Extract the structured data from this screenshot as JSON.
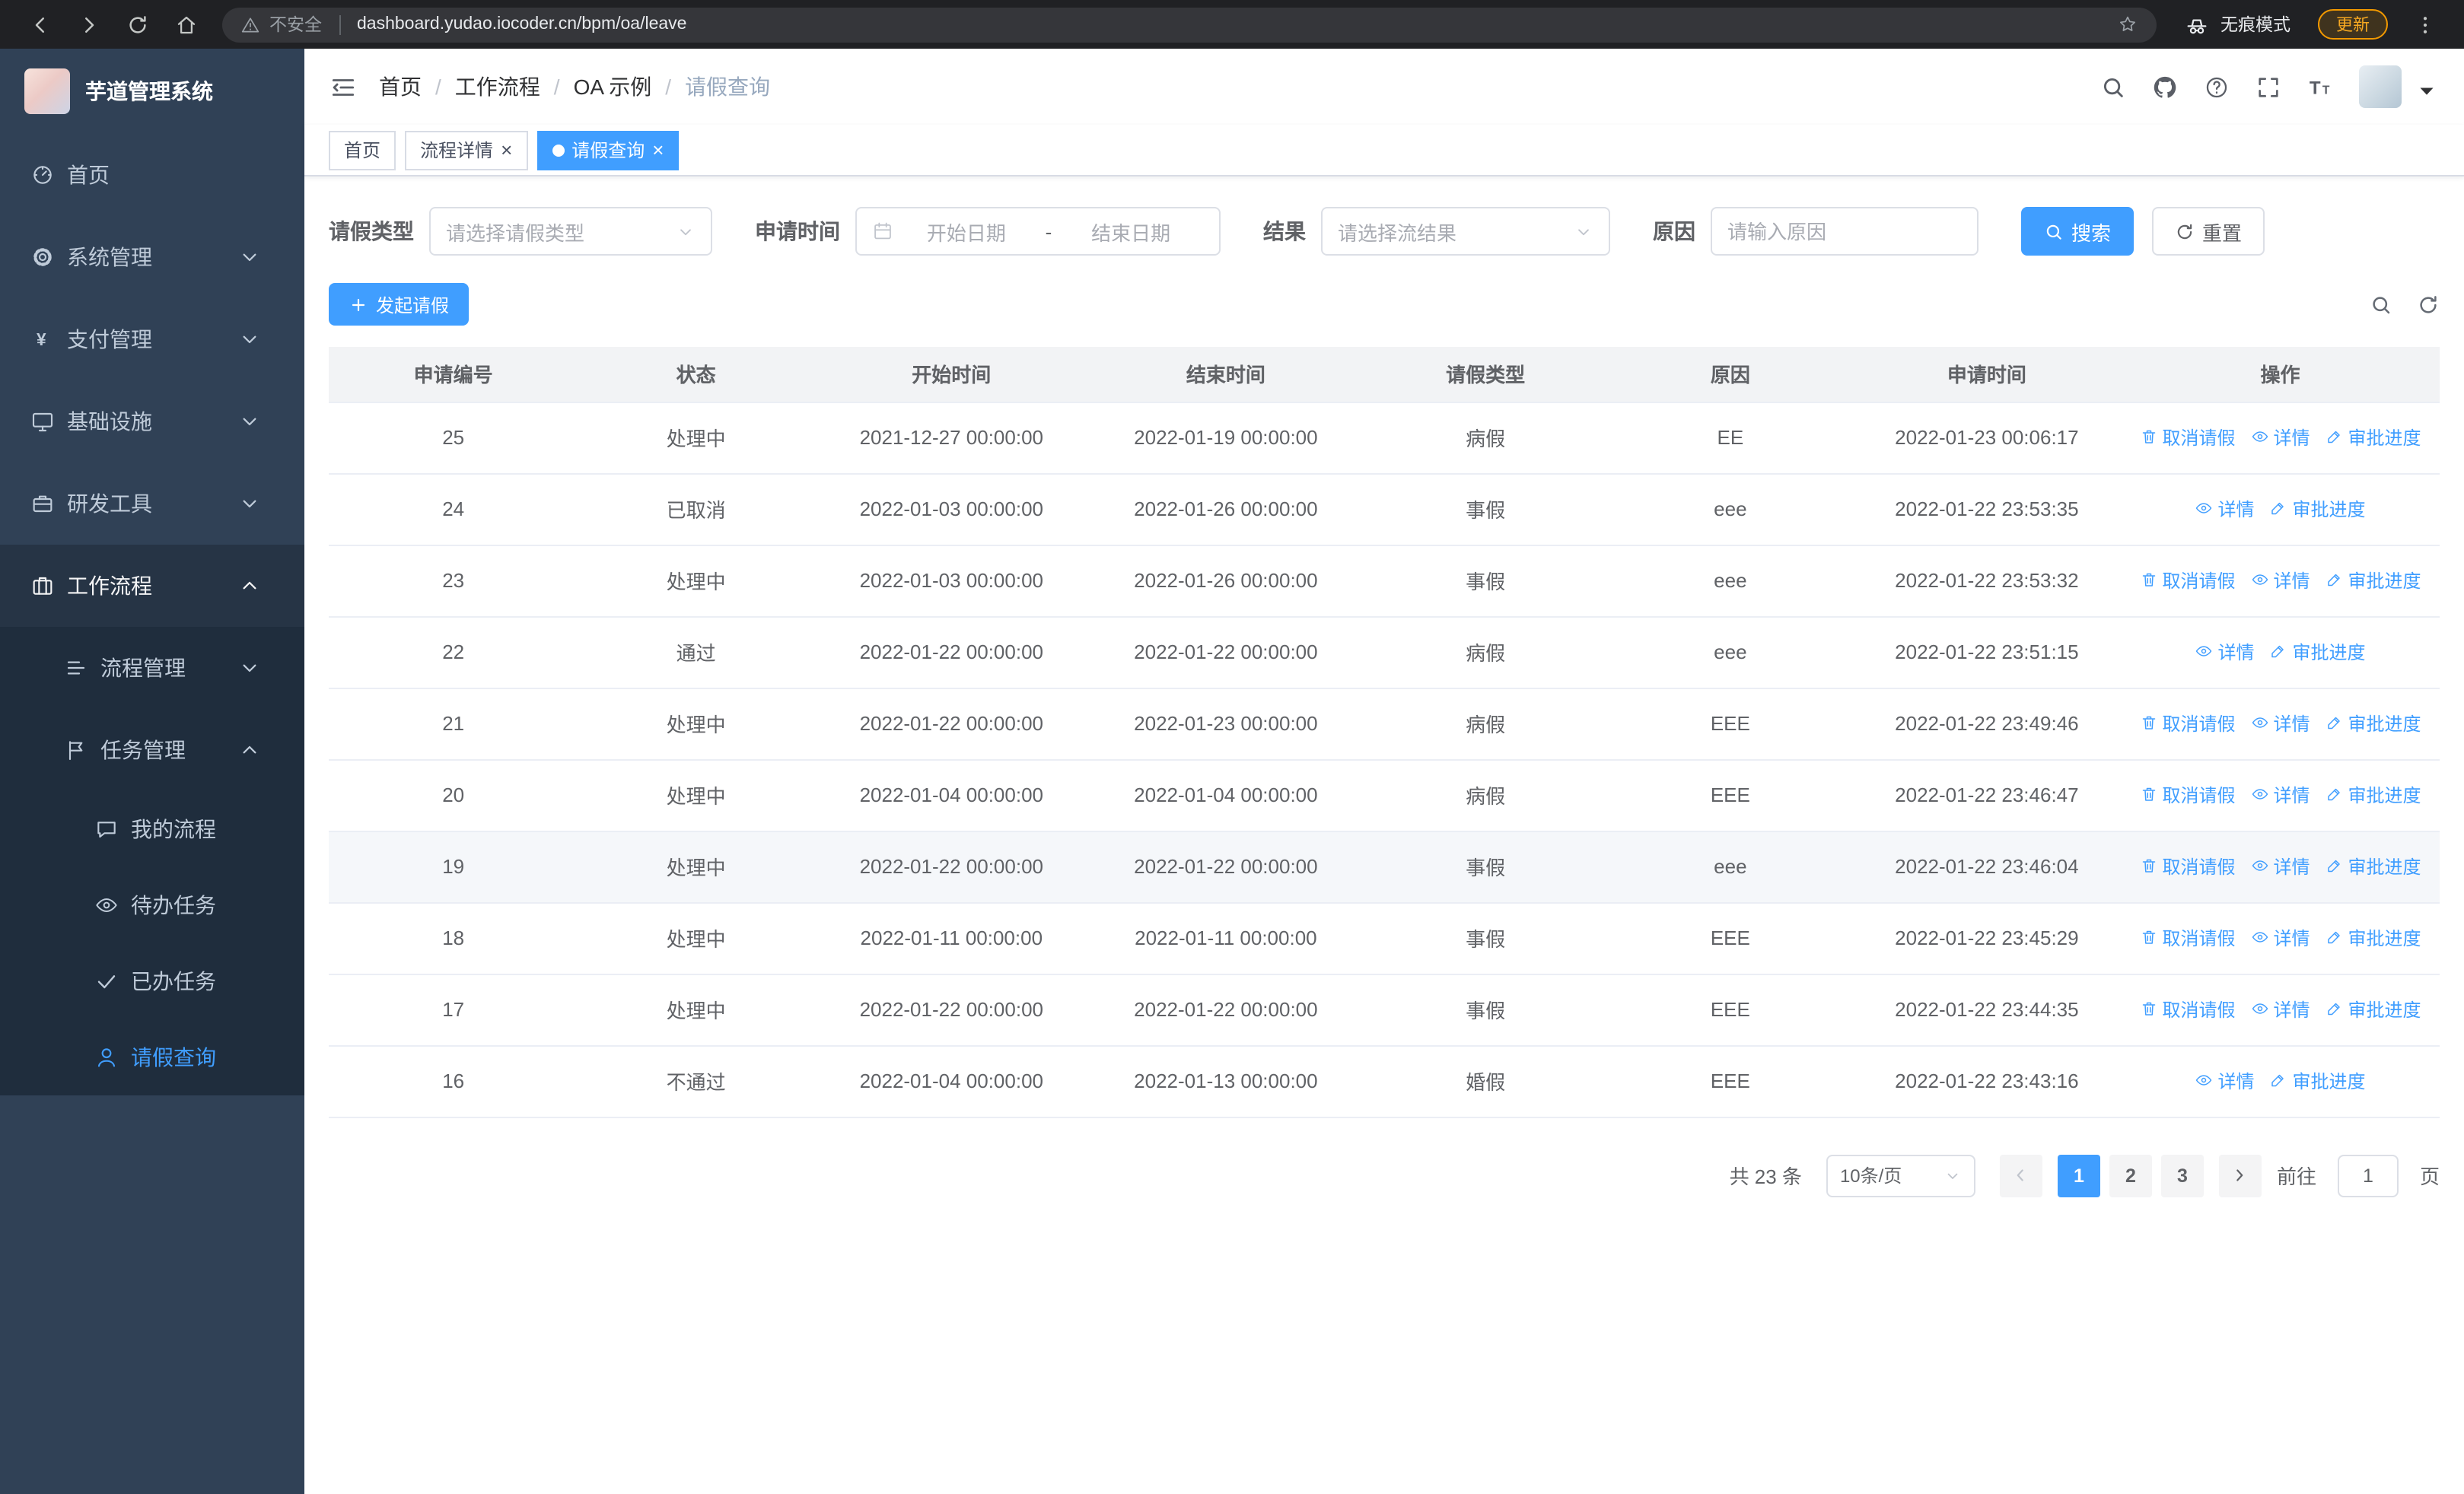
{
  "colors": {
    "accent": "#409eff",
    "sidebar_bg": "#304156",
    "sidebar_submenu_bg": "#1f2d3d",
    "browser_bar_bg": "#202124",
    "update_badge": "#f29900"
  },
  "browser": {
    "security_label": "不安全",
    "url": "dashboard.yudao.iocoder.cn/bpm/oa/leave",
    "incognito_label": "无痕模式",
    "update_label": "更新"
  },
  "sidebar": {
    "title": "芋道管理系统",
    "items": [
      {
        "key": "home",
        "label": "首页",
        "icon": "dashboard-icon",
        "level": 1
      },
      {
        "key": "system",
        "label": "系统管理",
        "icon": "gear-icon",
        "level": 1,
        "chevron": "down"
      },
      {
        "key": "payment",
        "label": "支付管理",
        "icon": "yen-icon",
        "level": 1,
        "chevron": "down"
      },
      {
        "key": "infrastructure",
        "label": "基础设施",
        "icon": "monitor-icon",
        "level": 1,
        "chevron": "down"
      },
      {
        "key": "devtools",
        "label": "研发工具",
        "icon": "briefcase-icon",
        "level": 1,
        "chevron": "down"
      },
      {
        "key": "workflow",
        "label": "工作流程",
        "icon": "suitcase-icon",
        "level": 1,
        "chevron": "up",
        "trail": true
      },
      {
        "key": "process-mgmt",
        "label": "流程管理",
        "icon": "list-icon",
        "level": 2,
        "chevron": "down"
      },
      {
        "key": "task-mgmt",
        "label": "任务管理",
        "icon": "flag-icon",
        "level": 2,
        "chevron": "up"
      },
      {
        "key": "my-process",
        "label": "我的流程",
        "icon": "chat-icon",
        "level": 3
      },
      {
        "key": "todo-task",
        "label": "待办任务",
        "icon": "eye-icon",
        "level": 3
      },
      {
        "key": "done-task",
        "label": "已办任务",
        "icon": "check-icon",
        "level": 3
      },
      {
        "key": "leave-query",
        "label": "请假查询",
        "icon": "user-icon",
        "level": 3,
        "active": true
      }
    ]
  },
  "header": {
    "breadcrumb": [
      "首页",
      "工作流程",
      "OA 示例",
      "请假查询"
    ]
  },
  "tabs": [
    {
      "key": "home",
      "label": "首页",
      "closable": false,
      "active": false
    },
    {
      "key": "process-detail",
      "label": "流程详情",
      "closable": true,
      "active": false
    },
    {
      "key": "leave-query",
      "label": "请假查询",
      "closable": true,
      "active": true
    }
  ],
  "filters": {
    "leave_type_label": "请假类型",
    "leave_type_placeholder": "请选择请假类型",
    "apply_time_label": "申请时间",
    "start_date_placeholder": "开始日期",
    "range_separator": "-",
    "end_date_placeholder": "结束日期",
    "result_label": "结果",
    "result_placeholder": "请选择流结果",
    "reason_label": "原因",
    "reason_placeholder": "请输入原因",
    "search_button": "搜索",
    "reset_button": "重置"
  },
  "toolbar": {
    "create_button": "发起请假"
  },
  "table": {
    "columns": [
      "申请编号",
      "状态",
      "开始时间",
      "结束时间",
      "请假类型",
      "原因",
      "申请时间",
      "操作"
    ],
    "actions": {
      "cancel": "取消请假",
      "detail": "详情",
      "progress": "审批进度"
    },
    "rows": [
      {
        "no": "25",
        "status": "处理中",
        "start_time": "2021-12-27 00:00:00",
        "end_time": "2022-01-19 00:00:00",
        "leave_type": "病假",
        "reason": "EE",
        "apply_time": "2022-01-23 00:06:17",
        "cancelable": true,
        "highlighted": false
      },
      {
        "no": "24",
        "status": "已取消",
        "start_time": "2022-01-03 00:00:00",
        "end_time": "2022-01-26 00:00:00",
        "leave_type": "事假",
        "reason": "eee",
        "apply_time": "2022-01-22 23:53:35",
        "cancelable": false,
        "highlighted": false
      },
      {
        "no": "23",
        "status": "处理中",
        "start_time": "2022-01-03 00:00:00",
        "end_time": "2022-01-26 00:00:00",
        "leave_type": "事假",
        "reason": "eee",
        "apply_time": "2022-01-22 23:53:32",
        "cancelable": true,
        "highlighted": false
      },
      {
        "no": "22",
        "status": "通过",
        "start_time": "2022-01-22 00:00:00",
        "end_time": "2022-01-22 00:00:00",
        "leave_type": "病假",
        "reason": "eee",
        "apply_time": "2022-01-22 23:51:15",
        "cancelable": false,
        "highlighted": false
      },
      {
        "no": "21",
        "status": "处理中",
        "start_time": "2022-01-22 00:00:00",
        "end_time": "2022-01-23 00:00:00",
        "leave_type": "病假",
        "reason": "EEE",
        "apply_time": "2022-01-22 23:49:46",
        "cancelable": true,
        "highlighted": false
      },
      {
        "no": "20",
        "status": "处理中",
        "start_time": "2022-01-04 00:00:00",
        "end_time": "2022-01-04 00:00:00",
        "leave_type": "病假",
        "reason": "EEE",
        "apply_time": "2022-01-22 23:46:47",
        "cancelable": true,
        "highlighted": false
      },
      {
        "no": "19",
        "status": "处理中",
        "start_time": "2022-01-22 00:00:00",
        "end_time": "2022-01-22 00:00:00",
        "leave_type": "事假",
        "reason": "eee",
        "apply_time": "2022-01-22 23:46:04",
        "cancelable": true,
        "highlighted": true
      },
      {
        "no": "18",
        "status": "处理中",
        "start_time": "2022-01-11 00:00:00",
        "end_time": "2022-01-11 00:00:00",
        "leave_type": "事假",
        "reason": "EEE",
        "apply_time": "2022-01-22 23:45:29",
        "cancelable": true,
        "highlighted": false
      },
      {
        "no": "17",
        "status": "处理中",
        "start_time": "2022-01-22 00:00:00",
        "end_time": "2022-01-22 00:00:00",
        "leave_type": "事假",
        "reason": "EEE",
        "apply_time": "2022-01-22 23:44:35",
        "cancelable": true,
        "highlighted": false
      },
      {
        "no": "16",
        "status": "不通过",
        "start_time": "2022-01-04 00:00:00",
        "end_time": "2022-01-13 00:00:00",
        "leave_type": "婚假",
        "reason": "EEE",
        "apply_time": "2022-01-22 23:43:16",
        "cancelable": false,
        "highlighted": false
      }
    ]
  },
  "pagination": {
    "total": "共 23 条",
    "page_size": "10条/页",
    "pages": [
      "1",
      "2",
      "3"
    ],
    "active_page": "1",
    "goto_label": "前往",
    "goto_value": "1",
    "goto_suffix": "页"
  }
}
